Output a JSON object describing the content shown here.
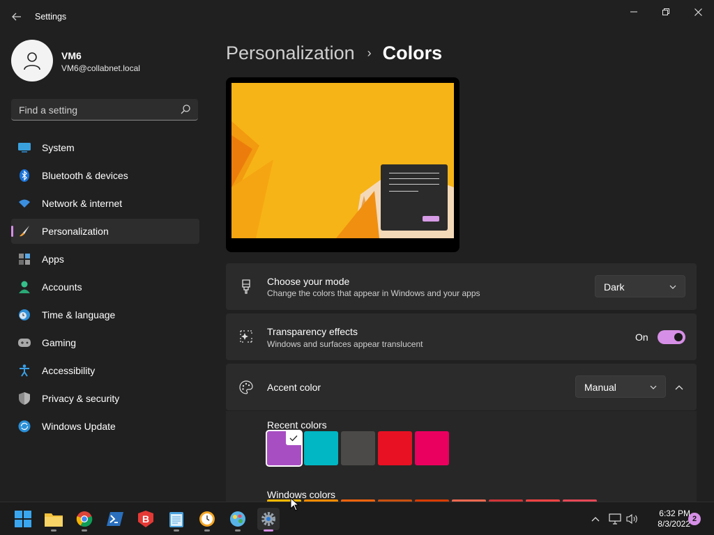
{
  "window": {
    "title": "Settings",
    "back_icon": "back-arrow-icon",
    "controls": [
      "minimize-icon",
      "restore-icon",
      "close-icon"
    ]
  },
  "profile": {
    "name": "VM6",
    "email": "VM6@collabnet.local"
  },
  "search": {
    "placeholder": "Find a setting"
  },
  "sidebar": {
    "items": [
      {
        "label": "System",
        "icon": "system-icon"
      },
      {
        "label": "Bluetooth & devices",
        "icon": "bluetooth-icon"
      },
      {
        "label": "Network & internet",
        "icon": "wifi-icon"
      },
      {
        "label": "Personalization",
        "icon": "brush-icon",
        "active": true
      },
      {
        "label": "Apps",
        "icon": "apps-icon"
      },
      {
        "label": "Accounts",
        "icon": "accounts-icon"
      },
      {
        "label": "Time & language",
        "icon": "clock-globe-icon"
      },
      {
        "label": "Gaming",
        "icon": "gamepad-icon"
      },
      {
        "label": "Accessibility",
        "icon": "accessibility-icon"
      },
      {
        "label": "Privacy & security",
        "icon": "shield-icon"
      },
      {
        "label": "Windows Update",
        "icon": "update-icon"
      }
    ]
  },
  "breadcrumb": {
    "parent": "Personalization",
    "separator": "›",
    "current": "Colors"
  },
  "mode": {
    "title": "Choose your mode",
    "subtitle": "Change the colors that appear in Windows and your apps",
    "value": "Dark"
  },
  "transparency": {
    "title": "Transparency effects",
    "subtitle": "Windows and surfaces appear translucent",
    "state_label": "On"
  },
  "accent": {
    "title": "Accent color",
    "value": "Manual",
    "recent_label": "Recent colors",
    "recent_colors": [
      "#a84ec3",
      "#00b7c3",
      "#4c4a48",
      "#e81123",
      "#ea005e"
    ],
    "selected_index": 0,
    "windows_label": "Windows colors",
    "windows_colors": [
      "#ffb900",
      "#ff8c00",
      "#f7630c",
      "#ca5010",
      "#da3b01",
      "#ef6950",
      "#d13438",
      "#ff4343",
      "#e74856"
    ]
  },
  "colors": {
    "accent": "#d68fe6",
    "background": "#202020",
    "card": "#2b2b2b"
  },
  "taskbar": {
    "apps": [
      "start-icon",
      "file-explorer-icon",
      "chrome-icon",
      "powershell-icon",
      "b-app-icon",
      "notepad-icon",
      "clock-app-icon",
      "paint-icon",
      "settings-icon"
    ],
    "time": "6:32 PM",
    "date": "8/3/2022",
    "notifications": "2"
  }
}
